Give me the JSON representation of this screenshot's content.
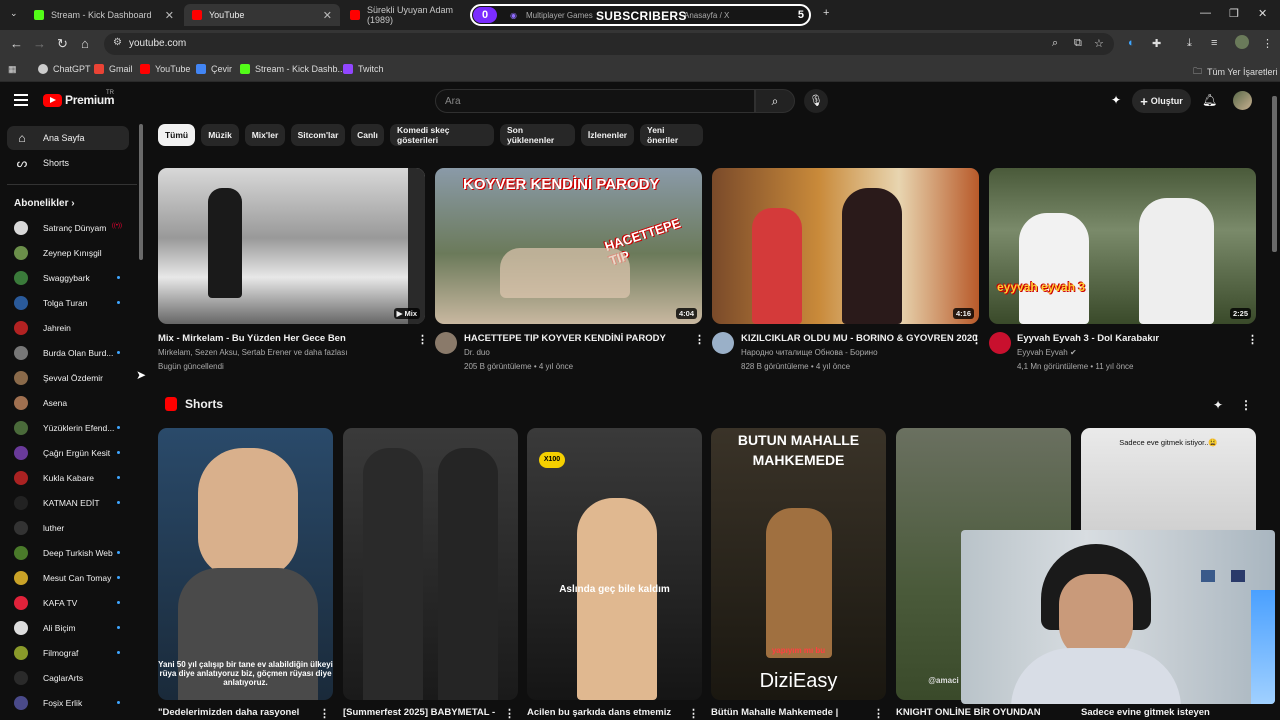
{
  "browser": {
    "tabs": [
      {
        "label": "Stream - Kick Dashboard",
        "color": "#53fc18"
      },
      {
        "label": "YouTube",
        "color": "#ff0000"
      },
      {
        "label": "Sürekli Uyuyan Adam (1989)",
        "color": "#ff0000"
      },
      {
        "label": "Multiplayer Games",
        "color": "#8f6cff"
      },
      {
        "label": "Anasayfa / X",
        "color": "#ffffff"
      }
    ],
    "new_tab_icon": "plus-icon",
    "url": "youtube.com",
    "bookmarks": [
      {
        "label": "ChatGPT",
        "color": "#cccccc"
      },
      {
        "label": "Gmail",
        "color": "#ea4335"
      },
      {
        "label": "YouTube",
        "color": "#ff0000"
      },
      {
        "label": "Çevir",
        "color": "#4285f4"
      },
      {
        "label": "Stream - Kick Dashb...",
        "color": "#53fc18"
      },
      {
        "label": "Twitch",
        "color": "#9146ff"
      }
    ],
    "all_bookmarks": "Tüm Yer İşaretleri"
  },
  "overlay": {
    "count": "0",
    "label": "SUBSCRIBERS",
    "goal": "5"
  },
  "yt": {
    "brand": "Premium",
    "country": "TR",
    "search_placeholder": "Ara",
    "create_label": "Oluştur",
    "nav": [
      {
        "label": "Ana Sayfa",
        "icon": "home-icon"
      },
      {
        "label": "Shorts",
        "icon": "shorts-icon"
      }
    ],
    "subs_title": "Abonelikler",
    "subscriptions": [
      {
        "label": "Satranç Dünyam",
        "color": "#d8d8d8",
        "badge": "live"
      },
      {
        "label": "Zeynep Kınışgil",
        "color": "#6b8f4a",
        "badge": "none"
      },
      {
        "label": "Swaggybark",
        "color": "#3a7a3a",
        "badge": "dot"
      },
      {
        "label": "Tolga Turan",
        "color": "#2a5a9a",
        "badge": "dot"
      },
      {
        "label": "Jahrein",
        "color": "#b22222",
        "badge": "none"
      },
      {
        "label": "Burda Olan Burd...",
        "color": "#777777",
        "badge": "dot"
      },
      {
        "label": "Şevval Özdemir",
        "color": "#8a6a4a",
        "badge": "none"
      },
      {
        "label": "Asena",
        "color": "#a07050",
        "badge": "none"
      },
      {
        "label": "Yüzüklerin Efend...",
        "color": "#4a6a3a",
        "badge": "dot"
      },
      {
        "label": "Çağrı Ergün Kesit",
        "color": "#6a3a9a",
        "badge": "dot"
      },
      {
        "label": "Kukla Kabare",
        "color": "#aa2222",
        "badge": "dot"
      },
      {
        "label": "KATMAN EDİT",
        "color": "#222222",
        "badge": "dot"
      },
      {
        "label": "luther",
        "color": "#333333",
        "badge": "none"
      },
      {
        "label": "Deep Turkish Web",
        "color": "#4a7a2a",
        "badge": "dot"
      },
      {
        "label": "Mesut Can Tomay",
        "color": "#c9a227",
        "badge": "dot"
      },
      {
        "label": "KAFA TV",
        "color": "#e0223a",
        "badge": "dot"
      },
      {
        "label": "Ali Biçim",
        "color": "#dddddd",
        "badge": "dot"
      },
      {
        "label": "Filmograf",
        "color": "#8a9a2a",
        "badge": "dot"
      },
      {
        "label": "CaglarArts",
        "color": "#2a2a2a",
        "badge": "none"
      },
      {
        "label": "Foşix Erlik",
        "color": "#4a4a8a",
        "badge": "dot"
      }
    ],
    "chips": [
      "Tümü",
      "Müzik",
      "Mix'ler",
      "Sitcom'lar",
      "Canlı",
      "Komedi skeç gösterileri",
      "Son yüklenenler",
      "İzlenenler",
      "Yeni öneriler"
    ],
    "videos": [
      {
        "title": "Mix - Mirkelam - Bu Yüzden Her Gece Ben",
        "channel": "Mirkelam, Sezen Aksu, Sertab Erener ve daha fazlası",
        "meta": "Bugün güncellendi",
        "badge": "Mix"
      },
      {
        "title": "HACETTEPE TIP KOYVER KENDİNİ PARODY",
        "channel": "Dr. duo",
        "meta": "205 B görüntüleme • 4 yıl önce",
        "badge": "4:04",
        "thumb_text": "KOYVER KENDİNİ PARODY",
        "thumb_text2": "HACETTEPE TIP"
      },
      {
        "title": "KIZILCIKLAR OLDU MU - BORINO & GYOVREN 2020",
        "channel": "Народно читалище Обнова - Борино",
        "meta": "828 B görüntüleme • 4 yıl önce",
        "badge": "4:16"
      },
      {
        "title": "Eyyvah Eyvah 3 - Dol Karabakır",
        "channel": "Eyyvah Eyvah",
        "meta": "4,1 Mn görüntüleme • 11 yıl önce",
        "badge": "2:25",
        "thumb_text": "eyyvah eyvah 3"
      }
    ],
    "shorts_title": "Shorts",
    "shorts": [
      {
        "title": "\"Dedelerimizden daha rasyonel",
        "caption": "Yani 50 yıl çalışıp bir tane ev alabildiğin ülkeyi rüya diye anlatıyoruz biz, göçmen rüyası diye anlatıyoruz."
      },
      {
        "title": "[Summerfest 2025] BABYMETAL -",
        "caption": ""
      },
      {
        "title": "Acilen bu şarkıda dans etmemiz",
        "caption": "Aslında geç bile kaldım",
        "tag": "X100"
      },
      {
        "title": "Bütün Mahalle Mahkemede |",
        "caption": "yapıyım mı bu",
        "top_text": "BUTUN MAHALLE MAHKEMEDE",
        "bottom_text": "DiziEasy"
      },
      {
        "title": "KNIGHT ONLİNE BİR OYUNDAN",
        "caption": "@amaci"
      },
      {
        "title": "Sadece evine gitmek isteyen",
        "caption": "Sadece eve gitmek istiyor..😩"
      }
    ]
  }
}
